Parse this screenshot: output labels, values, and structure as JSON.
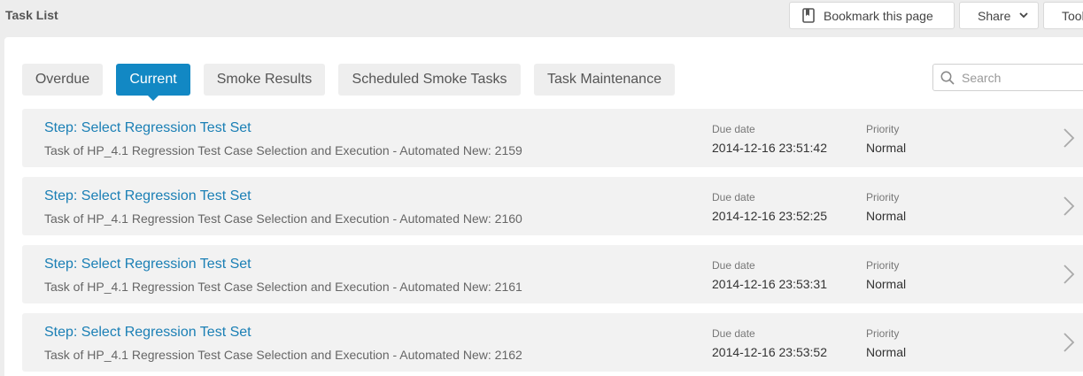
{
  "header": {
    "title": "Task List",
    "bookmark_label": "Bookmark this page",
    "share_label": "Share",
    "tools_label": "Tools"
  },
  "tabs": [
    {
      "label": "Overdue",
      "active": false
    },
    {
      "label": "Current",
      "active": true
    },
    {
      "label": "Smoke Results",
      "active": false
    },
    {
      "label": "Scheduled Smoke Tasks",
      "active": false
    },
    {
      "label": "Task Maintenance",
      "active": false
    }
  ],
  "search": {
    "placeholder": "Search",
    "value": ""
  },
  "tasks": [
    {
      "title": "Step: Select Regression Test Set",
      "description": "Task of HP_4.1 Regression Test Case Selection and Execution - Automated New: 2159",
      "due_label": "Due date",
      "due": "2014-12-16 23:51:42",
      "priority_label": "Priority",
      "priority": "Normal"
    },
    {
      "title": "Step: Select Regression Test Set",
      "description": "Task of HP_4.1 Regression Test Case Selection and Execution - Automated New: 2160",
      "due_label": "Due date",
      "due": "2014-12-16 23:52:25",
      "priority_label": "Priority",
      "priority": "Normal"
    },
    {
      "title": "Step: Select Regression Test Set",
      "description": "Task of HP_4.1 Regression Test Case Selection and Execution - Automated New: 2161",
      "due_label": "Due date",
      "due": "2014-12-16 23:53:31",
      "priority_label": "Priority",
      "priority": "Normal"
    },
    {
      "title": "Step: Select Regression Test Set",
      "description": "Task of HP_4.1 Regression Test Case Selection and Execution - Automated New: 2162",
      "due_label": "Due date",
      "due": "2014-12-16 23:53:52",
      "priority_label": "Priority",
      "priority": "Normal"
    }
  ],
  "colors": {
    "accent": "#1288c4",
    "link": "#1a7fb5"
  },
  "icons": {
    "bookmark": "bookmark-icon",
    "search": "search-icon",
    "open": "chevron-right-icon",
    "dropdown": "chevron-down-icon"
  }
}
